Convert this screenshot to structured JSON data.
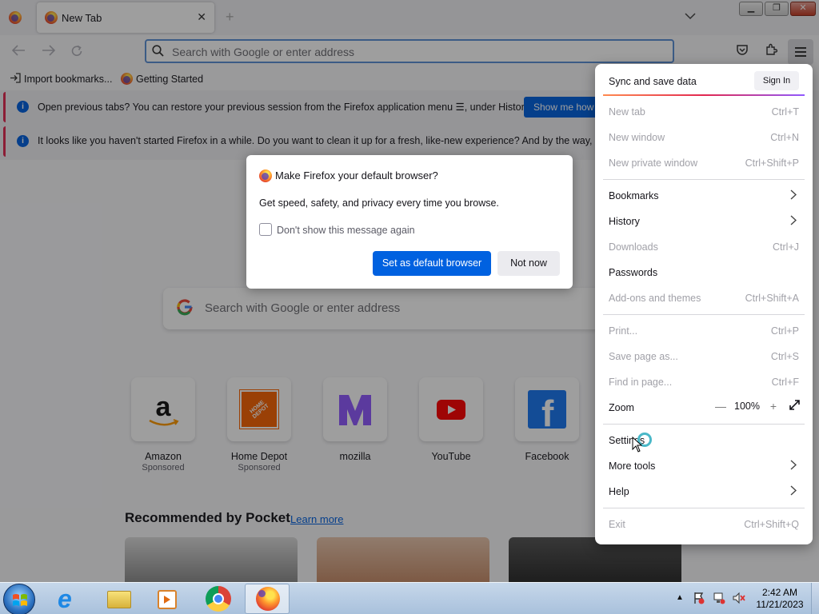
{
  "tab": {
    "title": "New Tab",
    "close": "✕"
  },
  "navbar": {
    "url_placeholder": "Search with Google or enter address"
  },
  "bookmarks": [
    {
      "label": "Import bookmarks..."
    },
    {
      "label": "Getting Started"
    }
  ],
  "notifications": [
    {
      "text": "Open previous tabs? You can restore your previous session from the Firefox application menu ☰, under History.",
      "button": "Show me how"
    },
    {
      "text": "It looks like you haven't started Firefox in a while. Do you want to clean it up for a fresh, like-new experience? And by the way, welcome",
      "button": ""
    }
  ],
  "dialog": {
    "title": "Make Firefox your default browser?",
    "body": "Get speed, safety, and privacy every time you browse.",
    "checkbox_label": "Don't show this message again",
    "primary": "Set as default browser",
    "secondary": "Not now"
  },
  "newtab": {
    "search_placeholder": "Search with Google or enter address",
    "tiles": [
      {
        "label": "Amazon",
        "sub": "Sponsored"
      },
      {
        "label": "Home Depot",
        "sub": "Sponsored"
      },
      {
        "label": "mozilla",
        "sub": ""
      },
      {
        "label": "YouTube",
        "sub": ""
      },
      {
        "label": "Facebook",
        "sub": ""
      }
    ],
    "pocket_heading": "Recommended by Pocket",
    "pocket_link": "Learn more"
  },
  "appmenu": {
    "sync_label": "Sync and save data",
    "signin": "Sign In",
    "items": [
      {
        "label": "New tab",
        "shortcut": "Ctrl+T",
        "disabled": true
      },
      {
        "label": "New window",
        "shortcut": "Ctrl+N",
        "disabled": true
      },
      {
        "label": "New private window",
        "shortcut": "Ctrl+Shift+P",
        "disabled": true
      },
      {
        "label": "Bookmarks",
        "shortcut": "",
        "disabled": false
      },
      {
        "label": "History",
        "shortcut": "",
        "disabled": false
      },
      {
        "label": "Downloads",
        "shortcut": "Ctrl+J",
        "disabled": true
      },
      {
        "label": "Passwords",
        "shortcut": "",
        "disabled": false
      },
      {
        "label": "Add-ons and themes",
        "shortcut": "Ctrl+Shift+A",
        "disabled": true
      },
      {
        "label": "Print...",
        "shortcut": "Ctrl+P",
        "disabled": true
      },
      {
        "label": "Save page as...",
        "shortcut": "Ctrl+S",
        "disabled": true
      },
      {
        "label": "Find in page...",
        "shortcut": "Ctrl+F",
        "disabled": true
      },
      {
        "label": "Zoom",
        "shortcut": "",
        "disabled": false
      },
      {
        "label": "Settings",
        "shortcut": "",
        "disabled": false
      },
      {
        "label": "More tools",
        "shortcut": "",
        "disabled": false
      },
      {
        "label": "Help",
        "shortcut": "",
        "disabled": false
      },
      {
        "label": "Exit",
        "shortcut": "Ctrl+Shift+Q",
        "disabled": true
      }
    ],
    "zoom": {
      "minus": "—",
      "value": "100%",
      "plus": "+"
    }
  },
  "taskbar": {
    "time": "2:42 AM",
    "date": "11/21/2023"
  },
  "colors": {
    "accent": "#0061e0",
    "notif_border": "#e22850"
  }
}
